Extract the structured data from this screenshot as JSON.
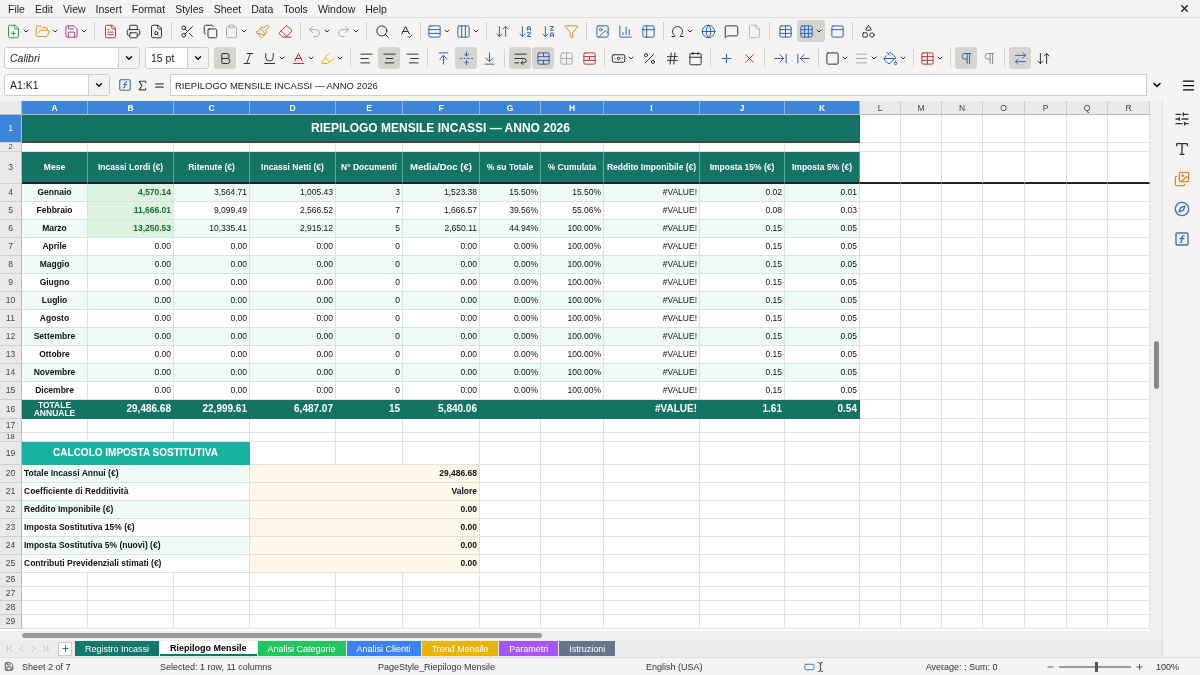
{
  "menu": [
    "File",
    "Edit",
    "View",
    "Insert",
    "Format",
    "Styles",
    "Sheet",
    "Data",
    "Tools",
    "Window",
    "Help"
  ],
  "standard_toolbar": [
    {
      "kind": "new",
      "selected": false
    },
    {
      "kind": "open",
      "selected": false
    },
    {
      "kind": "save",
      "selected": false
    },
    {
      "kind": "export-pdf",
      "selected": false
    },
    {
      "kind": "print",
      "selected": false
    },
    {
      "kind": "print-preview",
      "selected": false
    },
    {
      "kind": "cut",
      "selected": false
    },
    {
      "kind": "copy",
      "selected": false
    },
    {
      "kind": "paste",
      "selected": false
    },
    {
      "kind": "clone-format",
      "selected": false
    },
    {
      "kind": "clear-format",
      "selected": false
    },
    {
      "kind": "undo",
      "selected": false
    },
    {
      "kind": "redo",
      "selected": false
    },
    {
      "kind": "find",
      "selected": false
    },
    {
      "kind": "spelling",
      "selected": false
    },
    {
      "kind": "rows",
      "selected": false
    },
    {
      "kind": "columns",
      "selected": false
    },
    {
      "kind": "sort",
      "selected": false
    },
    {
      "kind": "sort-ascending",
      "selected": false
    },
    {
      "kind": "sort-descending",
      "selected": false
    },
    {
      "kind": "autofilter",
      "selected": false
    },
    {
      "kind": "image",
      "selected": false
    },
    {
      "kind": "chart",
      "selected": false
    },
    {
      "kind": "pivot-table",
      "selected": false
    },
    {
      "kind": "special-character",
      "selected": false
    },
    {
      "kind": "hyperlink",
      "selected": false
    },
    {
      "kind": "comment",
      "selected": false
    },
    {
      "kind": "header-footer",
      "selected": false
    },
    {
      "kind": "print-range",
      "selected": false
    },
    {
      "kind": "freeze",
      "selected": true
    },
    {
      "kind": "split",
      "selected": false
    },
    {
      "kind": "shapes",
      "selected": false
    }
  ],
  "formatting_toolbar": {
    "font": "Calibri",
    "size": "15 pt",
    "buttons": [
      {
        "kind": "bold",
        "selected": true
      },
      {
        "kind": "italic",
        "selected": false
      },
      {
        "kind": "underline",
        "selected": false
      },
      {
        "kind": "font-color",
        "selected": false
      },
      {
        "kind": "highlight",
        "selected": false
      },
      {
        "kind": "align-left",
        "selected": false
      },
      {
        "kind": "align-center",
        "selected": true
      },
      {
        "kind": "align-right",
        "selected": false
      },
      {
        "kind": "align-top",
        "selected": false
      },
      {
        "kind": "align-middle",
        "selected": true
      },
      {
        "kind": "align-bottom",
        "selected": false
      },
      {
        "kind": "wrap",
        "selected": true
      },
      {
        "kind": "merge-center",
        "selected": true
      },
      {
        "kind": "merge",
        "selected": false
      },
      {
        "kind": "unmerge",
        "selected": false
      },
      {
        "kind": "currency",
        "selected": false
      },
      {
        "kind": "percent",
        "selected": false
      },
      {
        "kind": "number",
        "selected": false
      },
      {
        "kind": "date",
        "selected": false
      },
      {
        "kind": "add-decimal",
        "selected": false
      },
      {
        "kind": "delete-decimal",
        "selected": false
      },
      {
        "kind": "indent",
        "selected": false
      },
      {
        "kind": "outdent",
        "selected": false
      },
      {
        "kind": "borders",
        "selected": false
      },
      {
        "kind": "border-style",
        "selected": false
      },
      {
        "kind": "border-color",
        "selected": false
      },
      {
        "kind": "conditional",
        "selected": false
      },
      {
        "kind": "left-to-right",
        "selected": true
      },
      {
        "kind": "right-to-left",
        "selected": false
      },
      {
        "kind": "text-direction",
        "selected": true
      },
      {
        "kind": "vertical-text",
        "selected": false
      }
    ]
  },
  "formula_bar": {
    "name_box": "A1:K1",
    "formula": "RIEPILOGO MENSILE INCASSI — ANNO 2026"
  },
  "columns": [
    {
      "label": "A",
      "selected": true
    },
    {
      "label": "B",
      "selected": true
    },
    {
      "label": "C",
      "selected": true
    },
    {
      "label": "D",
      "selected": true
    },
    {
      "label": "E",
      "selected": true
    },
    {
      "label": "F",
      "selected": true
    },
    {
      "label": "G",
      "selected": true
    },
    {
      "label": "H",
      "selected": true
    },
    {
      "label": "I",
      "selected": true
    },
    {
      "label": "J",
      "selected": true
    },
    {
      "label": "K",
      "selected": true
    },
    {
      "label": "L",
      "selected": false
    },
    {
      "label": "M",
      "selected": false
    },
    {
      "label": "N",
      "selected": false
    },
    {
      "label": "O",
      "selected": false
    },
    {
      "label": "P",
      "selected": false
    },
    {
      "label": "Q",
      "selected": false
    },
    {
      "label": "R",
      "selected": false
    }
  ],
  "rows": [
    {
      "number": "1",
      "kind": "title",
      "selected": true,
      "cells": [
        "RIEPILOGO MENSILE INCASSI — ANNO 2026"
      ]
    },
    {
      "number": "2",
      "kind": "spacer",
      "selected": false
    },
    {
      "number": "3",
      "kind": "header",
      "selected": false,
      "cells": [
        "Mese",
        "Incassi Lordi (€)",
        "Ritenute (€)",
        "Incassi Netti (€)",
        "N° Documenti",
        "Media/Doc (€)",
        "% su Totale",
        "% Cumulata",
        "Reddito Imponibile (€)",
        "Imposta 15% (€)",
        "Imposta 5% (€)"
      ]
    },
    {
      "number": "4",
      "kind": "data",
      "selected": false,
      "highlighted": true,
      "cells": [
        "Gennaio",
        "4,570.14",
        "3,564.71",
        "1,005.43",
        "3",
        "1,523.38",
        "15.50%",
        "15.50%",
        "#VALUE!",
        "0.02",
        "0.01"
      ]
    },
    {
      "number": "5",
      "kind": "data",
      "selected": false,
      "highlighted": true,
      "cells": [
        "Febbraio",
        "11,666.01",
        "9,099.49",
        "2,566.52",
        "7",
        "1,666.57",
        "39.56%",
        "55.06%",
        "#VALUE!",
        "0.08",
        "0.03"
      ]
    },
    {
      "number": "6",
      "kind": "data",
      "selected": false,
      "highlighted": true,
      "cells": [
        "Marzo",
        "13,250.53",
        "10,335.41",
        "2,915.12",
        "5",
        "2,650.11",
        "44.94%",
        "100.00%",
        "#VALUE!",
        "0.15",
        "0.05"
      ]
    },
    {
      "number": "7",
      "kind": "data",
      "selected": false,
      "highlighted": false,
      "cells": [
        "Aprile",
        "0.00",
        "0.00",
        "0.00",
        "0",
        "0.00",
        "0.00%",
        "100.00%",
        "#VALUE!",
        "0.15",
        "0.05"
      ]
    },
    {
      "number": "8",
      "kind": "data",
      "selected": false,
      "highlighted": false,
      "cells": [
        "Maggio",
        "0.00",
        "0.00",
        "0.00",
        "0",
        "0.00",
        "0.00%",
        "100.00%",
        "#VALUE!",
        "0.15",
        "0.05"
      ]
    },
    {
      "number": "9",
      "kind": "data",
      "selected": false,
      "highlighted": false,
      "cells": [
        "Giugno",
        "0.00",
        "0.00",
        "0.00",
        "0",
        "0.00",
        "0.00%",
        "100.00%",
        "#VALUE!",
        "0.15",
        "0.05"
      ]
    },
    {
      "number": "10",
      "kind": "data",
      "selected": false,
      "highlighted": false,
      "cells": [
        "Luglio",
        "0.00",
        "0.00",
        "0.00",
        "0",
        "0.00",
        "0.00%",
        "100.00%",
        "#VALUE!",
        "0.15",
        "0.05"
      ]
    },
    {
      "number": "11",
      "kind": "data",
      "selected": false,
      "highlighted": false,
      "cells": [
        "Agosto",
        "0.00",
        "0.00",
        "0.00",
        "0",
        "0.00",
        "0.00%",
        "100.00%",
        "#VALUE!",
        "0.15",
        "0.05"
      ]
    },
    {
      "number": "12",
      "kind": "data",
      "selected": false,
      "highlighted": false,
      "cells": [
        "Settembre",
        "0.00",
        "0.00",
        "0.00",
        "0",
        "0.00",
        "0.00%",
        "100.00%",
        "#VALUE!",
        "0.15",
        "0.05"
      ]
    },
    {
      "number": "13",
      "kind": "data",
      "selected": false,
      "highlighted": false,
      "cells": [
        "Ottobre",
        "0.00",
        "0.00",
        "0.00",
        "0",
        "0.00",
        "0.00%",
        "100.00%",
        "#VALUE!",
        "0.15",
        "0.05"
      ]
    },
    {
      "number": "14",
      "kind": "data",
      "selected": false,
      "highlighted": false,
      "cells": [
        "Novembre",
        "0.00",
        "0.00",
        "0.00",
        "0",
        "0.00",
        "0.00%",
        "100.00%",
        "#VALUE!",
        "0.15",
        "0.05"
      ]
    },
    {
      "number": "15",
      "kind": "data",
      "selected": false,
      "highlighted": false,
      "cells": [
        "Dicembre",
        "0.00",
        "0.00",
        "0.00",
        "0",
        "0.00",
        "0.00%",
        "100.00%",
        "#VALUE!",
        "0.15",
        "0.05"
      ]
    },
    {
      "number": "16",
      "kind": "total",
      "selected": false,
      "cells": [
        "TOTALE ANNUALE",
        "29,486.68",
        "22,999.61",
        "6,487.07",
        "15",
        "5,840.06",
        null,
        null,
        "#VALUE!",
        "1.61",
        "0.54"
      ]
    },
    {
      "number": "17",
      "kind": "empty",
      "selected": false
    },
    {
      "number": "18",
      "kind": "spacer",
      "selected": false
    },
    {
      "number": "19",
      "kind": "section",
      "selected": false,
      "cells": [
        "CALCOLO IMPOSTA SOSTITUTIVA"
      ]
    },
    {
      "number": "20",
      "kind": "calc",
      "selected": false,
      "cells": [
        "Totale Incassi Annui (€)",
        "29,486.68"
      ]
    },
    {
      "number": "21",
      "kind": "calc",
      "selected": false,
      "cells": [
        "Coefficiente di Redditività",
        "Valore"
      ]
    },
    {
      "number": "22",
      "kind": "calc",
      "selected": false,
      "cells": [
        "Reddito Imponibile (€)",
        "0.00"
      ]
    },
    {
      "number": "23",
      "kind": "calc",
      "selected": false,
      "cells": [
        "Imposta Sostitutiva 15% (€)",
        "0.00"
      ]
    },
    {
      "number": "24",
      "kind": "calc",
      "selected": false,
      "cells": [
        "Imposta Sostitutiva 5% (nuovi) (€)",
        "0.00"
      ]
    },
    {
      "number": "25",
      "kind": "calc",
      "selected": false,
      "cells": [
        "Contributi Previdenziali stimati (€)",
        "0.00"
      ]
    },
    {
      "number": "26",
      "kind": "empty",
      "selected": false
    },
    {
      "number": "27",
      "kind": "empty",
      "selected": false
    },
    {
      "number": "28",
      "kind": "empty",
      "selected": false
    },
    {
      "number": "29",
      "kind": "empty",
      "selected": false
    }
  ],
  "sheet_tabs": [
    {
      "label": "Registro Incassi",
      "color": "#11796c",
      "selected": false
    },
    {
      "label": "Riepilogo Mensile",
      "color": "#0f766e",
      "selected": true
    },
    {
      "label": "Analisi Categorie",
      "color": "#22c55e",
      "selected": false
    },
    {
      "label": "Analisi Clienti",
      "color": "#3b82f6",
      "selected": false
    },
    {
      "label": "Trend Mensile",
      "color": "#eab308",
      "selected": false
    },
    {
      "label": "Parametri",
      "color": "#a855f7",
      "selected": false
    },
    {
      "label": "Istruzioni",
      "color": "#64748b",
      "selected": false
    }
  ],
  "status_bar": {
    "sheet": "Sheet 2 of 7",
    "selection": "Selected: 1 row, 11 columns",
    "page_style": "PageStyle_Riepilogo Mensile",
    "language": "English (USA)",
    "summary": "Average: ; Sum: 0",
    "zoom": "100%",
    "level": 0.5
  }
}
